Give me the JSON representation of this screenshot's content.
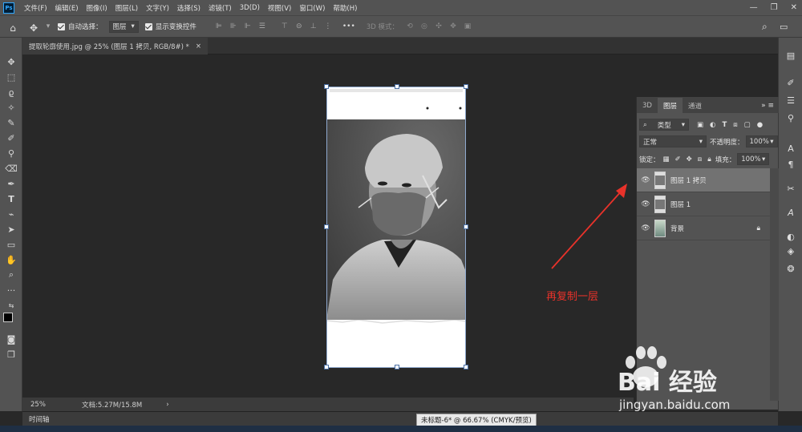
{
  "menu": [
    "文件(F)",
    "编辑(E)",
    "图像(I)",
    "图层(L)",
    "文字(Y)",
    "选择(S)",
    "滤镜(T)",
    "3D(D)",
    "视图(V)",
    "窗口(W)",
    "帮助(H)"
  ],
  "options": {
    "auto_select_label": "自动选择：",
    "auto_select_value": "图层",
    "show_transform_label": "显示变换控件",
    "mode_3d_label": "3D 模式："
  },
  "document_tab": {
    "title": "提取轮廓使用.jpg @ 25% (图层 1 拷贝, RGB/8#) *",
    "close": "×"
  },
  "status": {
    "zoom": "25%",
    "doc_size": "文档:5.27M/15.8M",
    "arrow": "›"
  },
  "timeline_label": "时间轴",
  "tooltip": "未标题-6* @ 66.67% (CMYK/预览)",
  "panel": {
    "tabs": [
      "3D",
      "图层",
      "通道"
    ],
    "filter_kind": "类型",
    "blend_mode": "正常",
    "opacity_label": "不透明度：",
    "opacity_value": "100%",
    "lock_label": "锁定：",
    "fill_label": "填充：",
    "fill_value": "100%",
    "layers": [
      {
        "name": "图层 1 拷贝",
        "selected": true,
        "locked": false
      },
      {
        "name": "图层 1",
        "selected": false,
        "locked": false
      },
      {
        "name": "背景",
        "selected": false,
        "locked": true
      }
    ]
  },
  "annotation": "再复制一层",
  "watermark": {
    "brand": "Bai 经验",
    "url": "jingyan.baidu.com"
  },
  "colors": {
    "annotation_red": "#e8322a",
    "ps_blue": "#31a8ff"
  }
}
